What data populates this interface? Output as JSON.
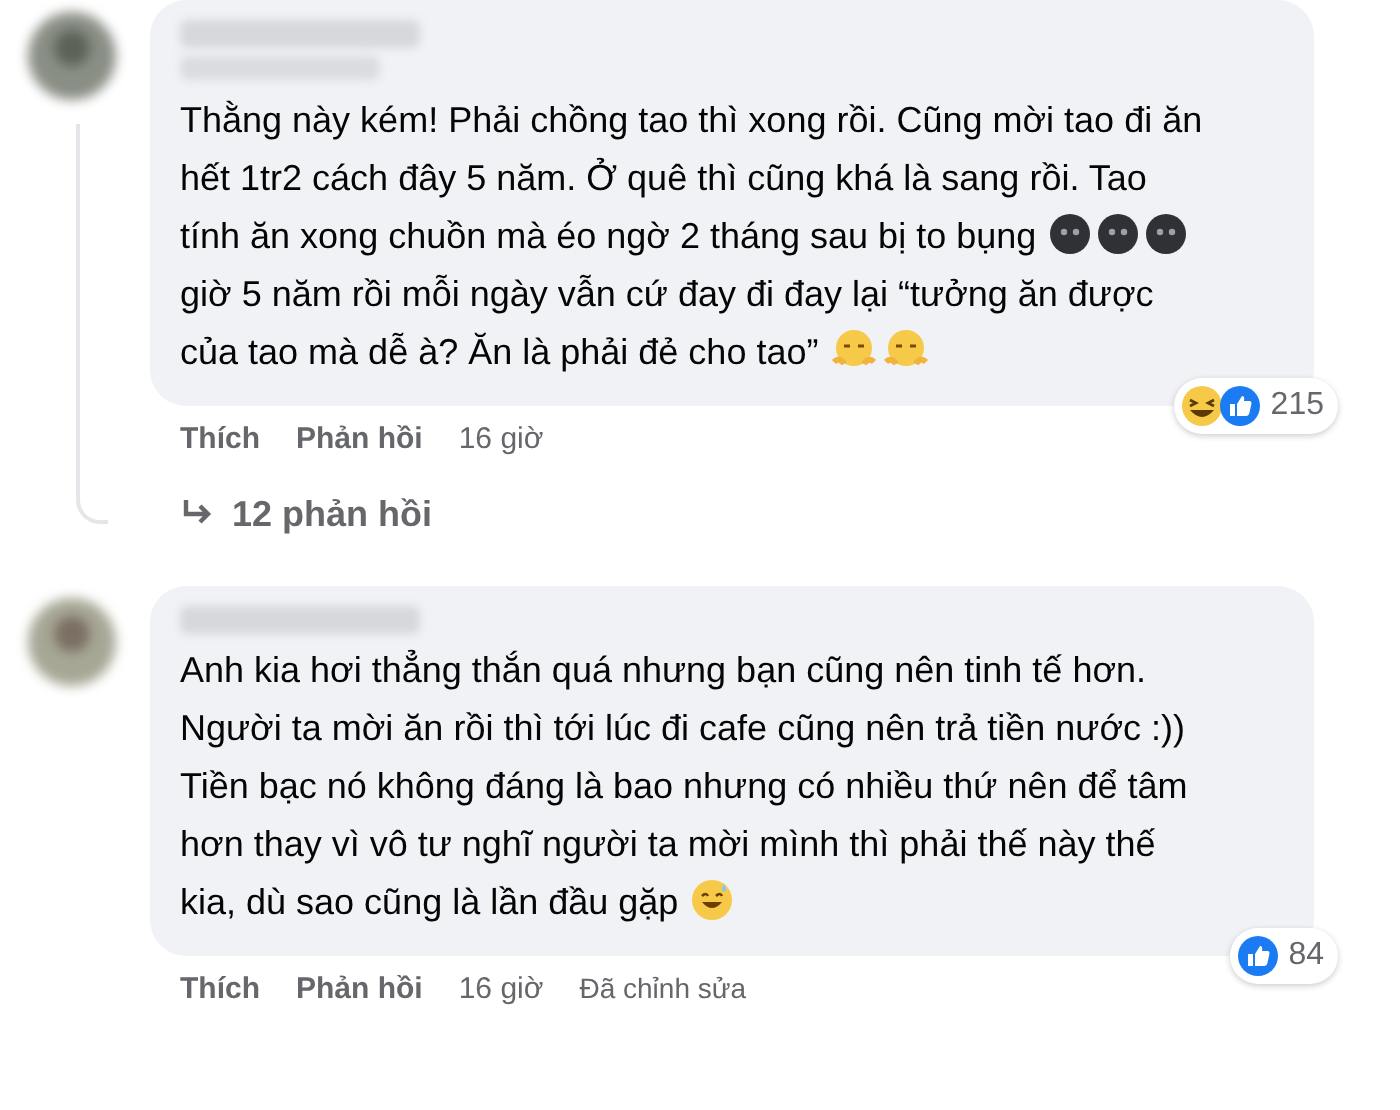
{
  "comments": [
    {
      "body": [
        {
          "kind": "text",
          "text": "Thằng này kém! Phải chồng tao thì xong rồi. Cũng mời tao đi ăn hết 1tr2 cách đây 5 năm. Ở quê thì cũng khá là sang rồi. Tao tính ăn xong chuồn mà éo ngờ 2 tháng sau bị to bụng "
        },
        {
          "kind": "blob"
        },
        {
          "kind": "blob"
        },
        {
          "kind": "blob"
        },
        {
          "kind": "text",
          "text": " giờ 5 năm rồi mỗi ngày vẫn cứ đay đi đay lại “tưởng ăn được của tao mà dễ à? Ăn là phải đẻ cho tao” "
        },
        {
          "kind": "huff"
        },
        {
          "kind": "huff"
        }
      ],
      "reactions": [
        {
          "kind": "haha"
        },
        {
          "kind": "like"
        }
      ],
      "reaction_count": "215",
      "actions": [
        "Thích",
        "Phản hồi"
      ],
      "time": "16 giờ",
      "replies": "12 phản hồi"
    },
    {
      "body": [
        {
          "kind": "text",
          "text": "Anh kia hơi thẳng thắn quá nhưng bạn cũng nên tinh tế hơn. Người ta mời ăn rồi thì tới lúc đi cafe cũng nên trả tiền nước :)) Tiền bạc nó không đáng là bao nhưng có nhiều thứ nên để tâm hơn thay vì vô tư nghĩ người ta mời mình thì phải thế này thế kia, dù sao cũng là lần đầu gặp "
        },
        {
          "kind": "grin"
        }
      ],
      "reactions": [
        {
          "kind": "like"
        }
      ],
      "reaction_count": "84",
      "actions": [
        "Thích",
        "Phản hồi"
      ],
      "time": "16 giờ",
      "edited": "Đã chỉnh sửa"
    }
  ]
}
